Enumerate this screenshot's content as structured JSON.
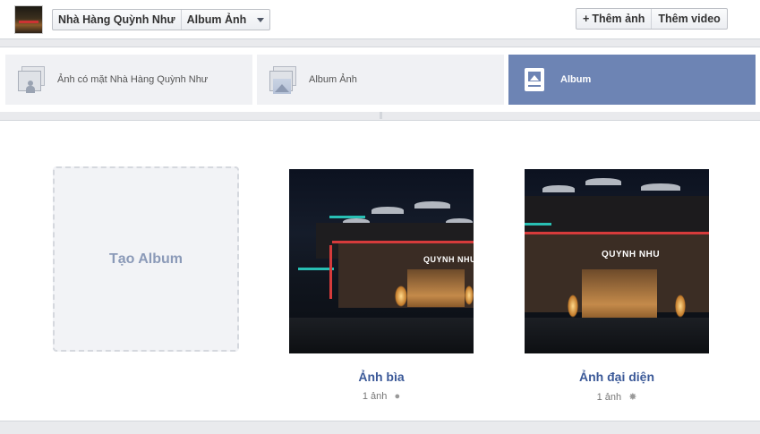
{
  "header": {
    "page_name": "Nhà Hàng Quỳnh Như",
    "section": "Album Ảnh",
    "add_photo": "Thêm ảnh",
    "add_photo_symbol": "+",
    "add_video": "Thêm video"
  },
  "tabs": [
    {
      "label": "Ảnh có mặt Nhà Hàng Quỳnh Như",
      "icon": "tagged-photos-icon",
      "active": false
    },
    {
      "label": "Album Ảnh",
      "icon": "photos-icon",
      "active": false
    },
    {
      "label": "Album",
      "icon": "album-icon",
      "active": true
    }
  ],
  "create_album": {
    "label": "Tạo Album"
  },
  "albums": [
    {
      "title": "Ảnh bìa",
      "count": "1 ảnh",
      "privacy_icon": "globe-icon",
      "photo_sign": "QUYNH NHU"
    },
    {
      "title": "Ảnh đại diện",
      "count": "1 ảnh",
      "privacy_icon": "gear-icon",
      "photo_sign": "QUYNH NHU"
    }
  ],
  "colors": {
    "accent": "#6d84b4",
    "link": "#3b5998",
    "create_album_text": "#8b9ab8"
  }
}
